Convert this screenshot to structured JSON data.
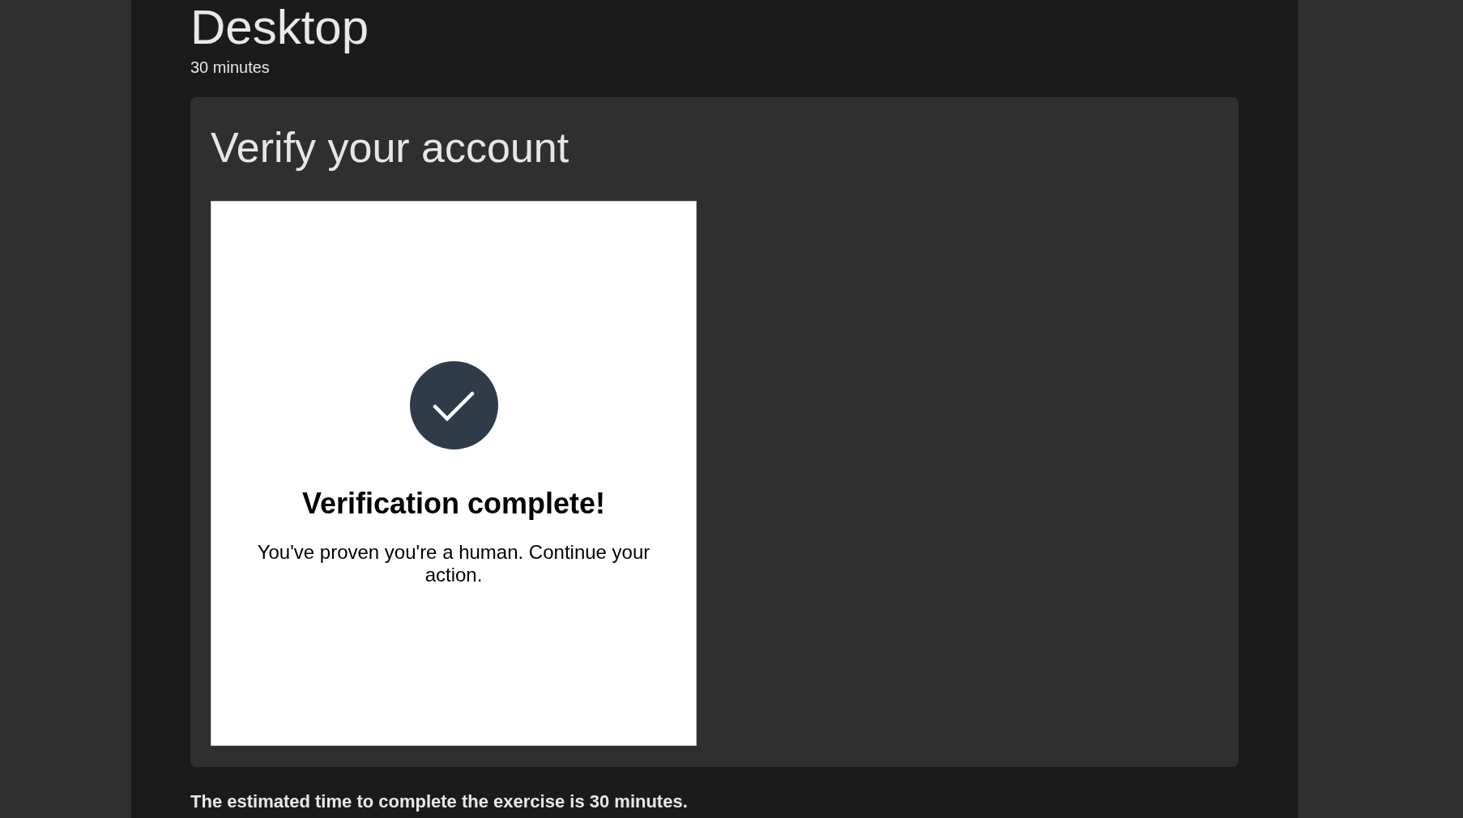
{
  "page": {
    "title": "Desktop",
    "duration": "30 minutes"
  },
  "card": {
    "title": "Verify your account",
    "verification": {
      "heading": "Verification complete!",
      "message": "You've proven you're a human. Continue your action."
    }
  },
  "footer_note": "The estimated time to complete the exercise is 30 minutes."
}
